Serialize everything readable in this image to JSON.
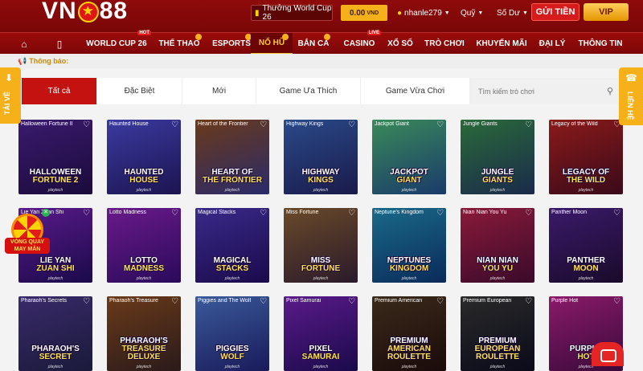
{
  "header": {
    "logo_text_left": "VN",
    "logo_text_right": "88",
    "promo": "Thưởng World Cup 26",
    "balance": "0.00",
    "balance_unit": "VND",
    "username": "nhanle279",
    "fund_label": "Quỹ",
    "debt_label": "Số Dư",
    "send_button": "GỬI TIỀN",
    "vip_button": "VIP"
  },
  "nav": {
    "items": [
      {
        "label": "",
        "icon": "home-icon"
      },
      {
        "label": "",
        "icon": "mobile-icon"
      },
      {
        "label": "WORLD CUP 26",
        "badge": "HOT"
      },
      {
        "label": "THỂ THAO"
      },
      {
        "label": "ESPORTS"
      },
      {
        "label": "NỔ HŨ",
        "active": true
      },
      {
        "label": "BẮN CÁ"
      },
      {
        "label": "CASINO",
        "badge": "LIVE"
      },
      {
        "label": "XỔ SỐ"
      },
      {
        "label": "TRÒ CHƠI"
      },
      {
        "label": "KHUYẾN MÃI"
      },
      {
        "label": "ĐẠI LÝ"
      },
      {
        "label": "THÔNG TIN"
      }
    ]
  },
  "notice": {
    "label": "Thông báo:"
  },
  "tabs": {
    "items": [
      "Tất cả",
      "Đặc Biệt",
      "Mới",
      "Game Ưa Thích",
      "Game Vừa Chơi"
    ],
    "search_placeholder": "Tìm kiếm trò chơi"
  },
  "floats": {
    "left_label": "TẢI VỀ",
    "right_label": "LIÊN HỆ",
    "lucky_line1": "VÒNG QUAY",
    "lucky_line2": "MAY MẮN"
  },
  "games": [
    {
      "title": "Halloween Fortune II",
      "l1": "HALLOWEEN",
      "l2": "FORTUNE 2",
      "c1": "#3a1a6e",
      "c2": "#1a0b3a"
    },
    {
      "title": "Haunted House",
      "l1": "HAUNTED",
      "l2": "HOUSE",
      "c1": "#3b3aa0",
      "c2": "#1c1450"
    },
    {
      "title": "Heart of the Frontier",
      "l1": "HEART OF",
      "l2": "THE FRONTIER",
      "c1": "#6a3a1a",
      "c2": "#2a2a6a"
    },
    {
      "title": "Highway Kings",
      "l1": "HIGHWAY",
      "l2": "KINGS",
      "c1": "#2a4a8a",
      "c2": "#1a1a4a"
    },
    {
      "title": "Jackpot Giant",
      "l1": "JACKPOT",
      "l2": "GIANT",
      "c1": "#3a8a5a",
      "c2": "#1a3a6a"
    },
    {
      "title": "Jungle Giants",
      "l1": "JUNGLE",
      "l2": "GIANTS",
      "c1": "#2a6a3a",
      "c2": "#1a2a4a"
    },
    {
      "title": "Legacy of the Wild",
      "l1": "LEGACY OF",
      "l2": "THE WILD",
      "c1": "#8a1a1a",
      "c2": "#3a0a1a"
    },
    {
      "title": "Lie Yan Zuan Shi",
      "l1": "LIE YAN",
      "l2": "ZUAN SHI",
      "c1": "#5a1a8a",
      "c2": "#1a0a4a"
    },
    {
      "title": "Lotto Madness",
      "l1": "LOTTO",
      "l2": "MADNESS",
      "c1": "#6a1a8a",
      "c2": "#2a0a5a"
    },
    {
      "title": "Magical Stacks",
      "l1": "MAGICAL",
      "l2": "STACKS",
      "c1": "#3a2a8a",
      "c2": "#1a0a4a"
    },
    {
      "title": "Miss Fortune",
      "l1": "MISS",
      "l2": "FORTUNE",
      "c1": "#6a4a2a",
      "c2": "#2a1a2a"
    },
    {
      "title": "Neptune's Kingdom",
      "l1": "NEPTUNES",
      "l2": "KINGDOM",
      "c1": "#1a6a8a",
      "c2": "#0a2a5a"
    },
    {
      "title": "Nian Nian You Yu",
      "l1": "NIAN NIAN",
      "l2": "YOU YU",
      "c1": "#8a1a3a",
      "c2": "#3a0a2a"
    },
    {
      "title": "Panther Moon",
      "l1": "PANTHER",
      "l2": "MOON",
      "c1": "#3a1a6a",
      "c2": "#1a0a2a"
    },
    {
      "title": "Pharaoh's Secrets",
      "l1": "PHARAOH'S",
      "l2": "SECRET",
      "c1": "#3a2a6a",
      "c2": "#1a1a3a"
    },
    {
      "title": "Pharaoh's Treasure",
      "l1": "PHARAOH'S",
      "l2": "TREASURE DELUXE",
      "c1": "#6a3a1a",
      "c2": "#2a1a1a"
    },
    {
      "title": "Piggies and The Wolf",
      "l1": "PIGGIES",
      "l2": "WOLF",
      "c1": "#3a5a9a",
      "c2": "#1a1a5a"
    },
    {
      "title": "Pixel Samurai",
      "l1": "PIXEL",
      "l2": "SAMURAI",
      "c1": "#5a1a8a",
      "c2": "#1a0a4a"
    },
    {
      "title": "Premium American",
      "l1": "PREMIUM",
      "l2": "AMERICAN ROULETTE",
      "c1": "#3a2a1a",
      "c2": "#1a0a0a"
    },
    {
      "title": "Premium European",
      "l1": "PREMIUM",
      "l2": "EUROPEAN ROULETTE",
      "c1": "#2a2a2a",
      "c2": "#0a0a1a"
    },
    {
      "title": "Purple Hot",
      "l1": "PURPLE",
      "l2": "HOT",
      "c1": "#8a1a6a",
      "c2": "#3a0a3a"
    }
  ],
  "provider_text": "playtech"
}
